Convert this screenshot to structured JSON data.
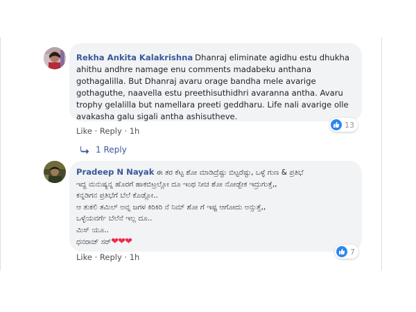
{
  "comment1": {
    "author": "Rekha Ankita Kalakrishna",
    "lines": [
      "Dhanraj eliminate agidhu estu dhukha",
      "ahithu andhre namage enu comments madabeku anthana",
      "gothagalilla. But Dhanraj avaru orage bandha mele avarige",
      "gothaguthe, naavella estu preethisuthidhri avaranna antha. Avaru",
      "trophy gelalilla but namellara preeti geddharu. Life nali avarige olle",
      "avakasha galu sigali antha ashisutheve."
    ],
    "reaction_count": "13",
    "like_label": "Like",
    "reply_label": "Reply",
    "time": "1h",
    "replies_label": "1 Reply"
  },
  "comment2": {
    "author": "Pradeep N Nayak",
    "lines": [
      "ಈ ತರ ಕೆಟ್ಟ ಶೋ ಮಾಡಿದ್ರೆಷ್ಟು ಬಿಟ್ಟರೆಷ್ಟು, ಒಳ್ಳೆ ಗುಣ & ಪ್ರತಿಭೆ",
      "ಇದ್ದ ಮನುಷ್ಯನ್ನ ಹೊರಗೆ ಹಾಕಬಿಟ್ರಲ್ಲೋ ದೂ ಇಂಥ ನೀಚ ಶೋ ನೋಡ್ಬೇಕ ಇದ್ರುಗುತ್ತೆ,,",
      "ಕನ್ನಡಿಗನ ಪ್ರತಿಭೆಗೆ ಬೆಲೆ ಕೊಡ್ಲೋ..",
      "ಆ ತುಕಲಿ ತಮಿಲ್ ಅವ್ನ ಜಗಳ ಕಿರಿಕಿರಿ ನೆ ನಿಮ್ ಶೋ ಗೆ ಇಷ್ಟ ಆಗೋದು ಅನ್ಸುತ್ತೆ,,",
      "ಒಳ್ಳೆಯವರ್ಗೆ ಬೆಲೆನೆ ಇಲ್ಲ ದೂ..",
      "ಮಿಸ್ ಯೂ..",
      "ಧನರಾಜ್ ಸರ್"
    ],
    "hearts": "❤❤❤",
    "reaction_count": "7",
    "like_label": "Like",
    "reply_label": "Reply",
    "time": "1h"
  },
  "separator": "·",
  "colors": {
    "link": "#385898",
    "bubble": "#f2f3f5",
    "like": "#2d86f0",
    "heart": "#f0284a"
  }
}
